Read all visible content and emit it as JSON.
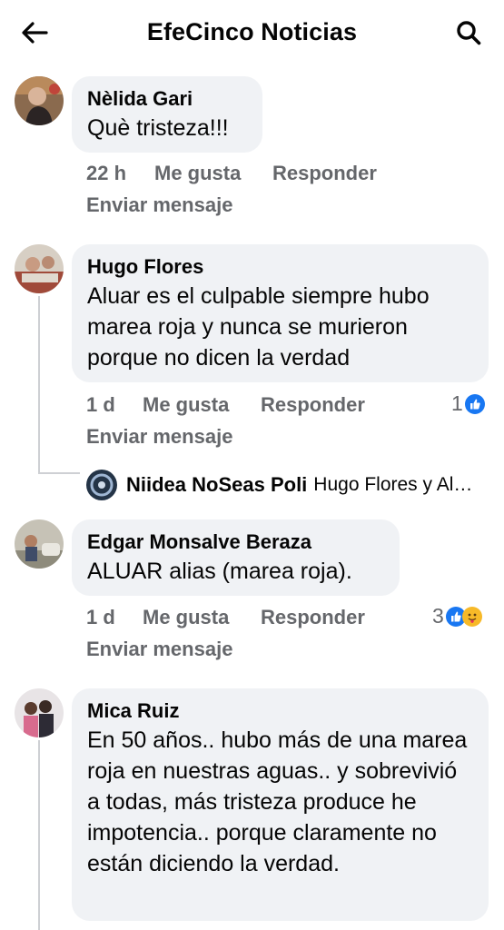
{
  "header": {
    "title": "EfeCinco Noticias",
    "back_icon": "arrow-left-icon",
    "search_icon": "search-icon"
  },
  "comments": [
    {
      "author": "Nèlida Gari",
      "text": "Què tristeza!!!",
      "time": "22 h",
      "like": "Me gusta",
      "reply": "Responder",
      "message": "Enviar mensaje"
    },
    {
      "author": "Hugo Flores",
      "text": "Aluar es el culpable siempre hubo marea roja y nunca se murieron porque no dicen la verdad",
      "time": "1 d",
      "like": "Me gusta",
      "reply": "Responder",
      "message": "Enviar mensaje",
      "reactions": "1"
    },
    {
      "author": "Edgar Monsalve Beraza",
      "text": "ALUAR alias (marea roja).",
      "time": "1 d",
      "like": "Me gusta",
      "reply": "Responder",
      "message": "Enviar mensaje",
      "reactions": "3"
    },
    {
      "author": "Mica Ruiz",
      "text": "En 50 años.. hubo más de una marea roja en nuestras aguas.. y sobrevivió a todas, más tristeza produce he impotencia.. porque claramente no están diciendo la verdad."
    }
  ],
  "reply_preview": {
    "author": "Niidea NoSeas Poli",
    "text": "Hugo Flores y Al…"
  },
  "colors": {
    "like_blue": "#1877f2",
    "bubble": "#f0f2f5",
    "meta_gray": "#65676b",
    "care_yellow": "#f7b928"
  }
}
